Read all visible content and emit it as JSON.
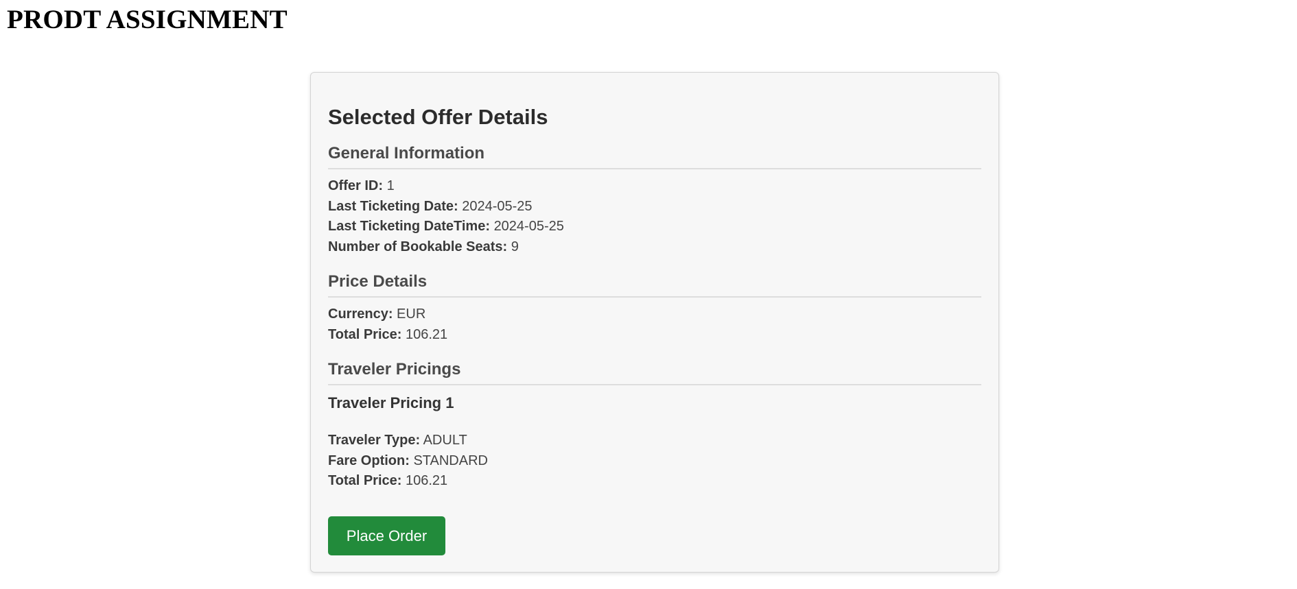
{
  "app": {
    "title": "PRODT ASSIGNMENT"
  },
  "offer": {
    "heading": "Selected Offer Details",
    "general": {
      "title": "General Information",
      "fields": [
        {
          "label": "Offer ID:",
          "value": "1"
        },
        {
          "label": "Last Ticketing Date:",
          "value": "2024-05-25"
        },
        {
          "label": "Last Ticketing DateTime:",
          "value": "2024-05-25"
        },
        {
          "label": "Number of Bookable Seats:",
          "value": "9"
        }
      ]
    },
    "price": {
      "title": "Price Details",
      "fields": [
        {
          "label": "Currency:",
          "value": "EUR"
        },
        {
          "label": "Total Price:",
          "value": "106.21"
        }
      ]
    },
    "traveler_pricings": {
      "title": "Traveler Pricings",
      "items": [
        {
          "title": "Traveler Pricing 1",
          "fields": [
            {
              "label": "Traveler Type:",
              "value": "ADULT"
            },
            {
              "label": "Fare Option:",
              "value": "STANDARD"
            },
            {
              "label": "Total Price:",
              "value": "106.21"
            }
          ]
        }
      ]
    },
    "place_order_label": "Place Order"
  },
  "colors": {
    "button_bg": "#228b3b",
    "card_bg": "#f7f7f7"
  }
}
